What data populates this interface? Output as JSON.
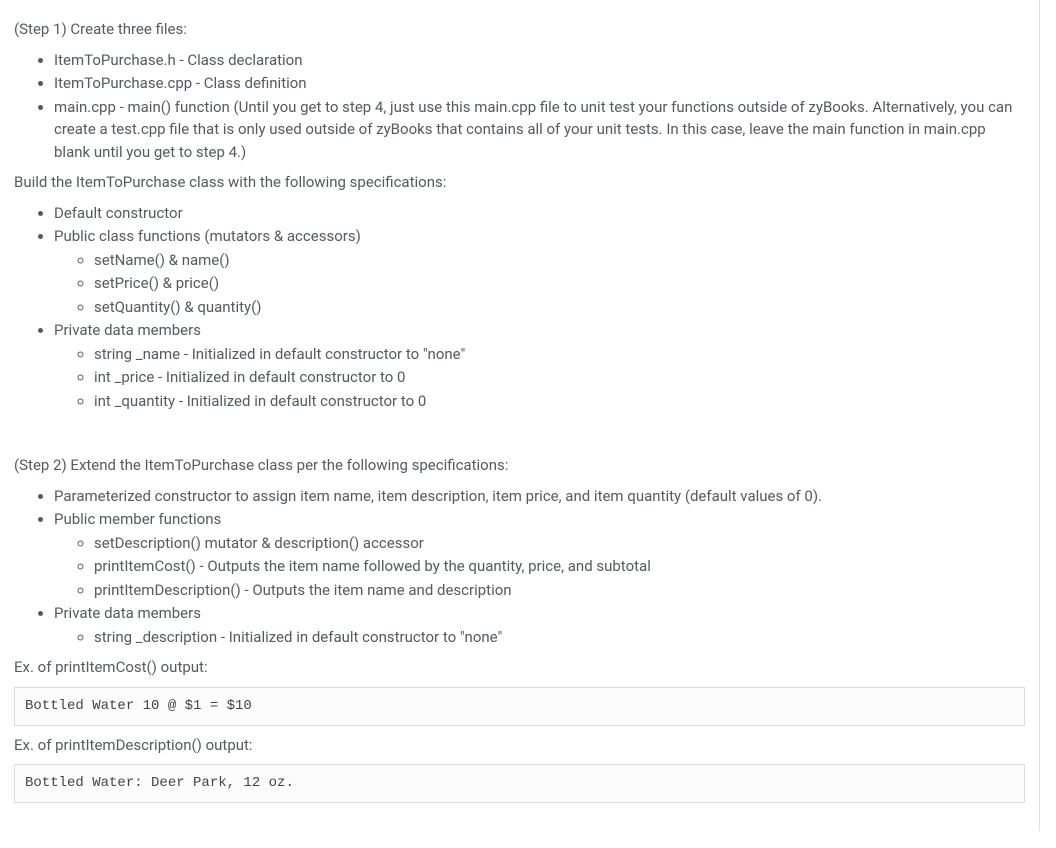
{
  "step1": {
    "intro": "(Step 1) Create three files:",
    "files": [
      "ItemToPurchase.h - Class declaration",
      "ItemToPurchase.cpp - Class definition",
      "main.cpp - main() function (Until you get to step 4, just use this main.cpp file to unit test your functions outside of zyBooks. Alternatively, you can create a test.cpp file that is only used outside of zyBooks that contains all of your unit tests. In this case, leave the main function in main.cpp blank until you get to step 4.)"
    ],
    "build_intro": "Build the ItemToPurchase class with the following specifications:",
    "specs": {
      "default_ctor": "Default constructor",
      "public_fns_label": "Public class functions (mutators & accessors)",
      "public_fns": [
        "setName() & name()",
        "setPrice() & price()",
        "setQuantity() & quantity()"
      ],
      "private_label": "Private data members",
      "private_members": [
        "string _name - Initialized in default constructor to \"none\"",
        "int _price - Initialized in default constructor to 0",
        "int _quantity - Initialized in default constructor to 0"
      ]
    }
  },
  "step2": {
    "intro": "(Step 2) Extend the ItemToPurchase class per the following specifications:",
    "specs": {
      "param_ctor": "Parameterized constructor to assign item name, item description, item price, and item quantity (default values of 0).",
      "public_fns_label": "Public member functions",
      "public_fns": [
        "setDescription() mutator & description() accessor",
        "printItemCost() - Outputs the item name followed by the quantity, price, and subtotal",
        "printItemDescription() - Outputs the item name and description"
      ],
      "private_label": "Private data members",
      "private_members": [
        "string _description - Initialized in default constructor to \"none\""
      ]
    },
    "ex_cost_label": "Ex. of printItemCost() output:",
    "ex_cost_output": "Bottled Water 10 @ $1 = $10",
    "ex_desc_label": "Ex. of printItemDescription() output:",
    "ex_desc_output": "Bottled Water: Deer Park, 12 oz."
  }
}
